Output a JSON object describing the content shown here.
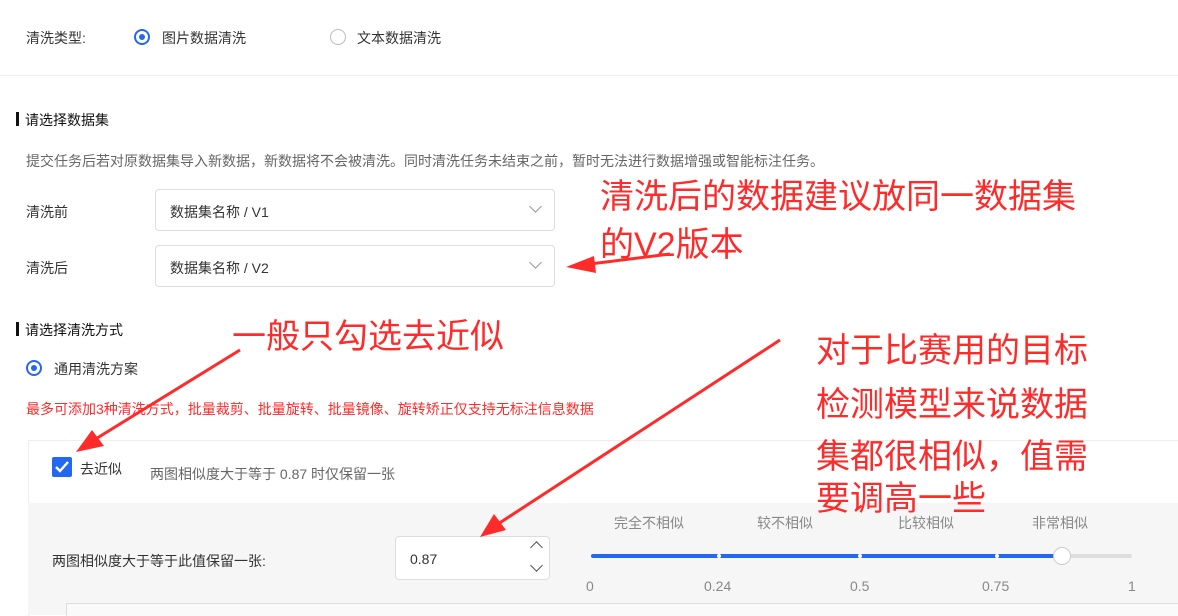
{
  "clean_type": {
    "label": "清洗类型:",
    "options": [
      {
        "label": "图片数据清洗",
        "selected": true
      },
      {
        "label": "文本数据清洗",
        "selected": false
      }
    ]
  },
  "dataset_section": {
    "title": "请选择数据集",
    "note": "提交任务后若对原数据集导入新数据，新数据将不会被清洗。同时清洗任务未结束之前，暂时无法进行数据增强或智能标注任务。",
    "before_label": "清洗前",
    "before_value": "数据集名称 / V1",
    "after_label": "清洗后",
    "after_value": "数据集名称 / V2"
  },
  "method_section": {
    "title": "请选择清洗方式",
    "scheme_label": "通用清洗方案",
    "warning": "最多可添加3种清洗方式，批量裁剪、批量旋转、批量镜像、旋转矫正仅支持无标注信息数据"
  },
  "dedup": {
    "checked": true,
    "label": "去近似",
    "desc": "两图相似度大于等于 0.87 时仅保留一张",
    "threshold_label": "两图相似度大于等于此值保留一张:",
    "threshold_value": "0.87",
    "similarity_labels": [
      "完全不相似",
      "较不相似",
      "比较相似",
      "非常相似"
    ],
    "scale_ticks": [
      "0",
      "0.24",
      "0.5",
      "0.75",
      "1"
    ],
    "slider_value": 0.87
  },
  "annotations": {
    "a1_line1": "清洗后的数据建议放同一数据集",
    "a1_line2": "的V2版本",
    "a2": "一般只勾选去近似",
    "a3_lines": [
      "对于比赛用的目标",
      "检测模型来说数据",
      "集都很相似，值需",
      "要调高一些"
    ]
  },
  "colors": {
    "accent": "#2468f2",
    "warning": "#ff2a2a"
  }
}
